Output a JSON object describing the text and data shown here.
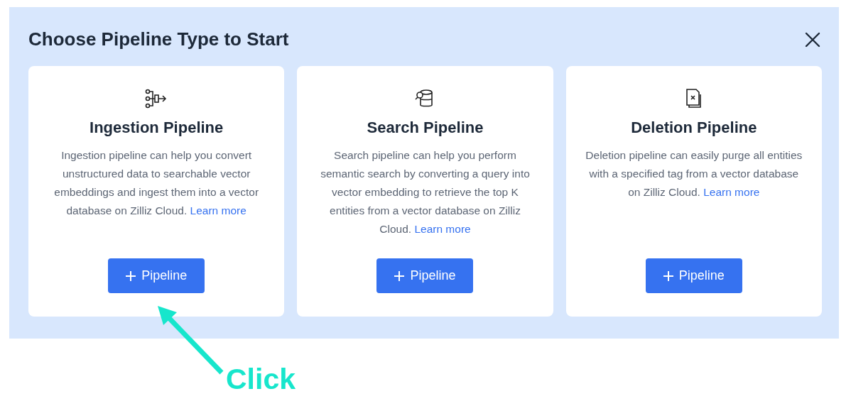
{
  "dialog": {
    "title": "Choose Pipeline Type to Start"
  },
  "cards": [
    {
      "kind": "ingestion",
      "title": "Ingestion Pipeline",
      "description": "Ingestion pipeline can help you convert unstructured data to searchable vector embeddings and ingest them into a vector database on Zilliz Cloud.",
      "link": "Learn more",
      "button": "Pipeline"
    },
    {
      "kind": "search",
      "title": "Search Pipeline",
      "description": "Search pipeline can help you perform semantic search by converting a query into vector embedding to retrieve the top K entities from a vector database on Zilliz Cloud.",
      "link": "Learn more",
      "button": "Pipeline"
    },
    {
      "kind": "deletion",
      "title": "Deletion Pipeline",
      "description": "Deletion pipeline can easily purge all entities with a specified tag from a vector database on Zilliz Cloud.",
      "link": "Learn more",
      "button": "Pipeline"
    }
  ],
  "annotation": {
    "text": "Click"
  }
}
